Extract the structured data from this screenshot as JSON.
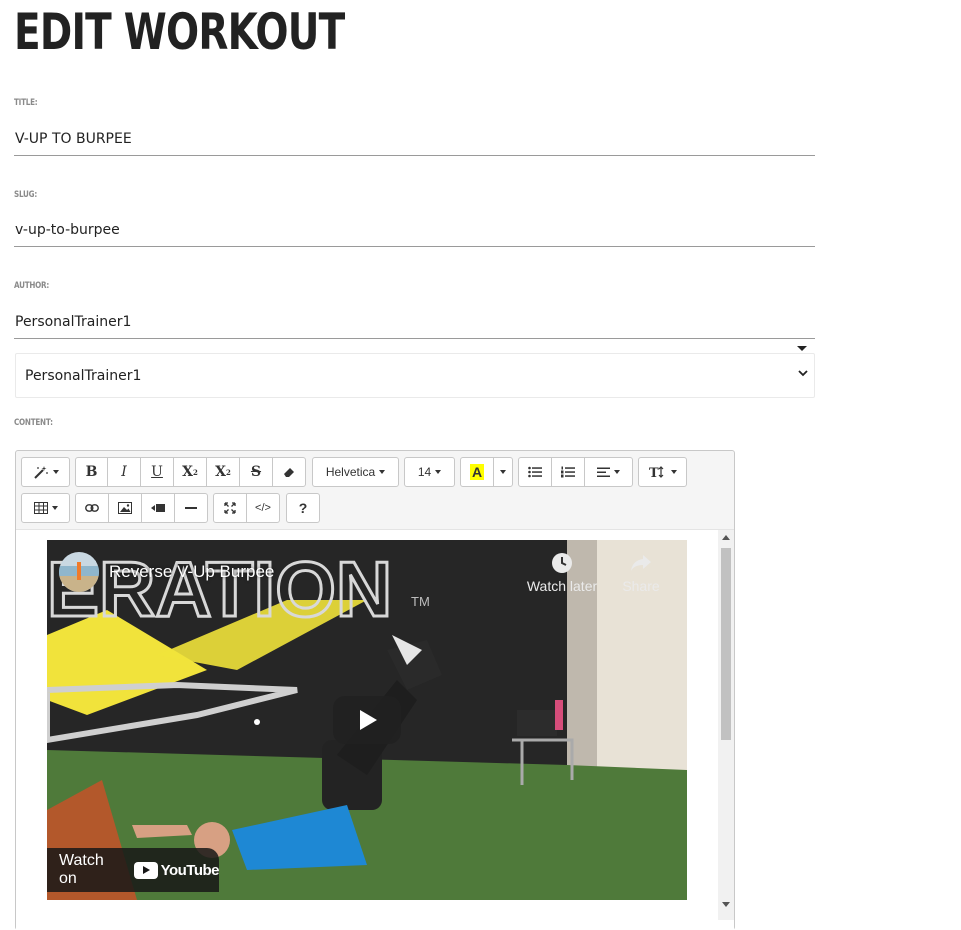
{
  "page": {
    "title": "EDIT WORKOUT"
  },
  "fields": {
    "title": {
      "label": "TITLE:",
      "value": "V-UP TO BURPEE"
    },
    "slug": {
      "label": "SLUG:",
      "value": "v-up-to-burpee"
    },
    "author": {
      "label": "AUTHOR:",
      "value": "PersonalTrainer1",
      "select_value": "PersonalTrainer1"
    },
    "content": {
      "label": "CONTENT:"
    }
  },
  "toolbar": {
    "font_family": "Helvetica",
    "font_size": "14",
    "color_letter": "A",
    "help": "?",
    "code_label": "</>"
  },
  "video": {
    "title": "Reverse V-Up Burpee",
    "watch_later": "Watch later",
    "share": "Share",
    "watch_on": "Watch on",
    "youtube": "YouTube",
    "wall_text": "ERATION",
    "tm": "TM"
  },
  "colors": {
    "highlight_yellow": "#ffff00",
    "wall_logo_yellow": "#f1e33b",
    "turf_green": "#4f7a3a",
    "shirt_blue": "#1e88d4"
  }
}
